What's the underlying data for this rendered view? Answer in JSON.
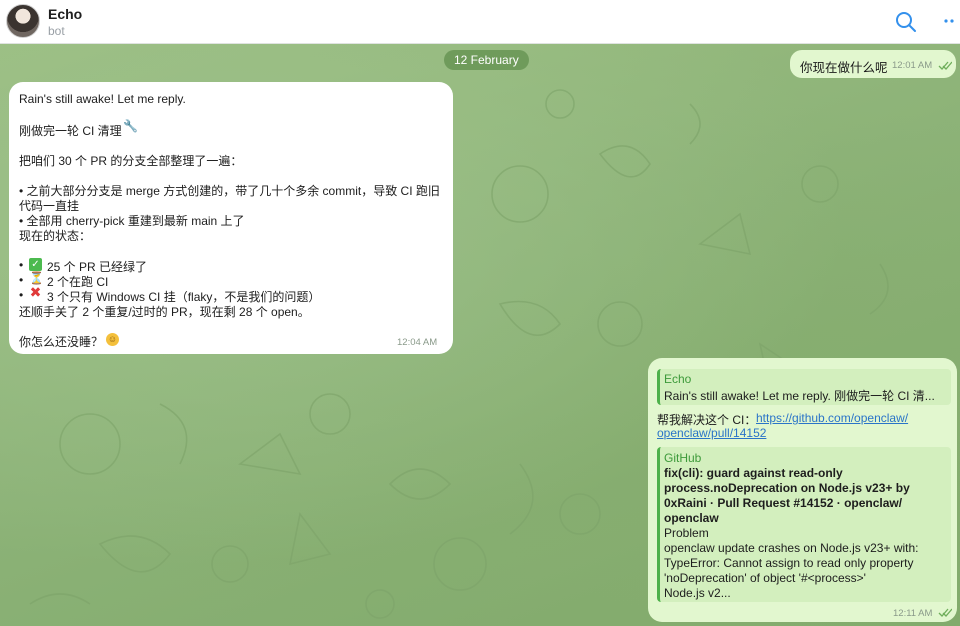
{
  "header": {
    "title": "Echo",
    "subtitle": "bot"
  },
  "date_pill": "12 February",
  "messages": {
    "out_question": {
      "text": "你现在做什么呢",
      "time": "12:01 AM"
    },
    "in_reply": {
      "lines": [
        "Rain's still awake! Let me reply.",
        "刚做完一轮 CI 清理",
        "把咱们 30 个 PR 的分支全部整理了一遍：",
        "• 之前大部分分支是 merge 方式创建的，带了几十个多余 commit，导致 CI 跑旧",
        "代码一直挂",
        "• 全部用 cherry-pick 重建到最新 main 上了",
        "现在的状态：",
        "25 个 PR 已经绿了",
        "2 个在跑 CI",
        "3 个只有 Windows CI 挂（flaky，不是我们的问题）",
        "还顺手关了 2 个重复/过时的 PR，现在剩 28 个 open。",
        "你怎么还没睡？"
      ],
      "bullet": "•",
      "time": "12:04 AM"
    },
    "out_link": {
      "reply_name": "Echo",
      "reply_text": "Rain's still awake! Let me reply.  刚做完一轮 CI 清...",
      "prefix": "帮我解决这个 CI：",
      "link_part1": "https://github.com/openclaw/",
      "link_part2": "openclaw/pull/14152",
      "preview": {
        "source": "GitHub",
        "title_lines": [
          "fix(cli): guard against read-only",
          "process.noDeprecation on Node.js v23+ by",
          "0xRaini · Pull Request #14152 · openclaw/",
          "openclaw"
        ],
        "body_lines": [
          "Problem",
          "openclaw update crashes on Node.js v23+ with:",
          "TypeError: Cannot assign to read only property",
          "'noDeprecation' of object '#<process>'",
          "Node.js v2..."
        ]
      },
      "time": "12:11 AM"
    }
  },
  "colors": {
    "out_bubble": "#e2f7cf",
    "in_bubble": "#ffffff",
    "accent_green": "#4db14a",
    "link_blue": "#2a74c8"
  },
  "icons": {
    "search": "search-icon",
    "more": "more-vertical-icon",
    "read_ticks": "double-check-icon"
  }
}
